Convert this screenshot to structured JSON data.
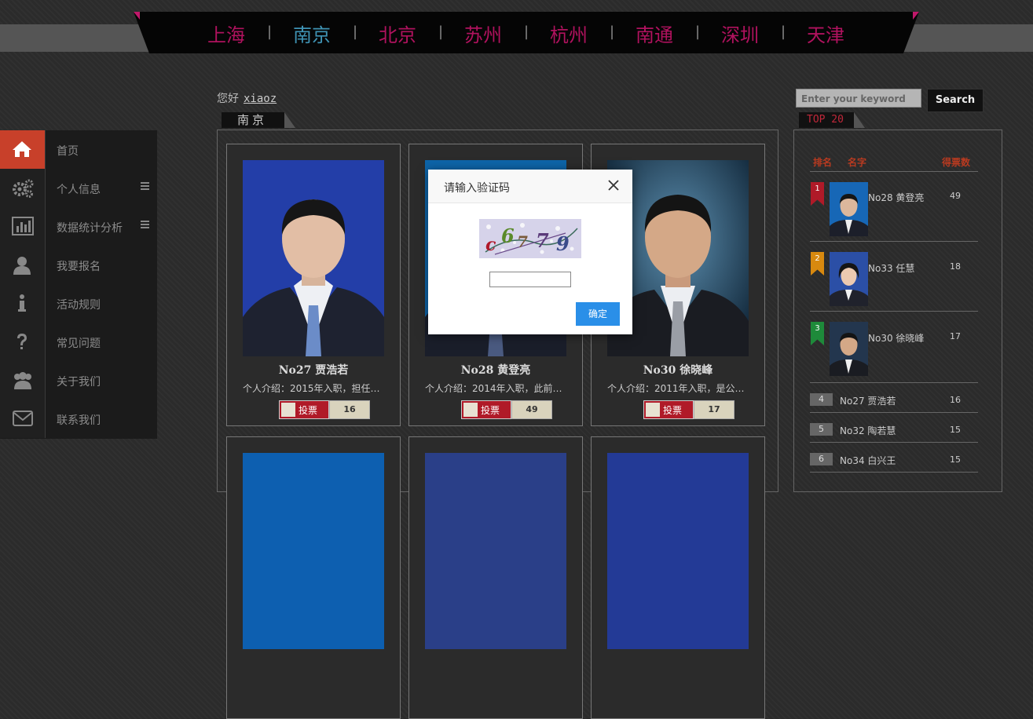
{
  "cities": [
    {
      "label": "上海",
      "active": false
    },
    {
      "label": "南京",
      "active": true
    },
    {
      "label": "北京",
      "active": false
    },
    {
      "label": "苏州",
      "active": false
    },
    {
      "label": "杭州",
      "active": false
    },
    {
      "label": "南通",
      "active": false
    },
    {
      "label": "深圳",
      "active": false
    },
    {
      "label": "天津",
      "active": false
    }
  ],
  "city_separator": "|",
  "sidebar": {
    "items": [
      {
        "label": "首页",
        "icon": "home-icon",
        "active": true
      },
      {
        "label": "个人信息",
        "icon": "gears-icon",
        "has_menu": true
      },
      {
        "label": "数据统计分析",
        "icon": "bar-chart-icon",
        "has_menu": true
      },
      {
        "label": "我要报名",
        "icon": "user-icon"
      },
      {
        "label": "活动规则",
        "icon": "info-icon"
      },
      {
        "label": "常见问题",
        "icon": "question-icon"
      },
      {
        "label": "关于我们",
        "icon": "users-icon"
      },
      {
        "label": "联系我们",
        "icon": "envelope-icon"
      }
    ]
  },
  "greeting": {
    "text": "您好",
    "username": "xiaoz"
  },
  "main": {
    "section_title": "南京",
    "cards": [
      {
        "name": "No27 贾浩若",
        "intro": "个人介绍：2015年入职，担任…",
        "vote_label": "投票",
        "votes": "16"
      },
      {
        "name": "No28 黄登亮",
        "intro": "个人介绍：2014年入职，此前…",
        "vote_label": "投票",
        "votes": "49"
      },
      {
        "name": "No30 徐晓峰",
        "intro": "个人介绍：2011年入职，是公…",
        "vote_label": "投票",
        "votes": "17"
      }
    ]
  },
  "search": {
    "placeholder": "Enter your keyword",
    "button_label": "Search"
  },
  "top20": {
    "title": "TOP 20",
    "headers": {
      "rank": "排名",
      "name": "名字",
      "votes": "得票数"
    },
    "top3": [
      {
        "rank": "1",
        "name": "No28 黄登亮",
        "votes": "49",
        "color": "#b01a28"
      },
      {
        "rank": "2",
        "name": "No33 任慧",
        "votes": "18",
        "color": "#d8890f"
      },
      {
        "rank": "3",
        "name": "No30 徐晓峰",
        "votes": "17",
        "color": "#1e8a3a"
      }
    ],
    "rest": [
      {
        "rank": "4",
        "name": "No27 贾浩若",
        "votes": "16"
      },
      {
        "rank": "5",
        "name": "No32 陶若慧",
        "votes": "15"
      },
      {
        "rank": "6",
        "name": "No34 白兴王",
        "votes": "15"
      }
    ]
  },
  "modal": {
    "title": "请输入验证码",
    "captcha_text": "c67·9",
    "input_value": "",
    "ok_label": "确定"
  }
}
